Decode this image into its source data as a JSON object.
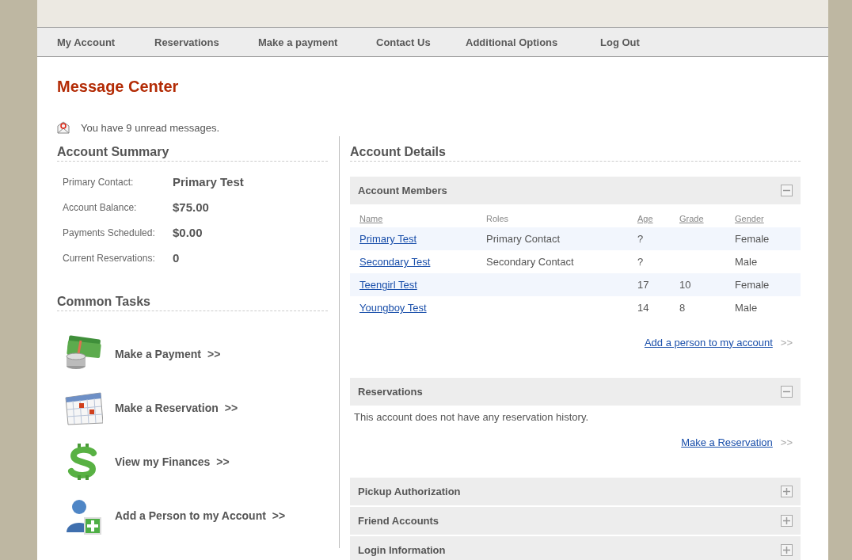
{
  "nav": [
    {
      "label": "My Account"
    },
    {
      "label": "Reservations"
    },
    {
      "label": "Make a payment"
    },
    {
      "label": "Contact Us"
    },
    {
      "label": "Additional Options"
    },
    {
      "label": "Log Out"
    }
  ],
  "page_title": "Message Center",
  "unread_notice": "You have 9 unread messages.",
  "account_summary": {
    "heading": "Account Summary",
    "rows": [
      {
        "label": "Primary Contact:",
        "value": "Primary Test"
      },
      {
        "label": "Account Balance:",
        "value": "$75.00"
      },
      {
        "label": "Payments Scheduled:",
        "value": "$0.00"
      },
      {
        "label": "Current Reservations:",
        "value": "0"
      }
    ]
  },
  "common_tasks": {
    "heading": "Common Tasks",
    "items": [
      {
        "kind": "payment",
        "label": "Make a Payment",
        "arrow": ">>"
      },
      {
        "kind": "calendar",
        "label": "Make a Reservation",
        "arrow": ">>"
      },
      {
        "kind": "dollar",
        "label": "View my Finances",
        "arrow": ">>"
      },
      {
        "kind": "person",
        "label": "Add a Person to my Account",
        "arrow": ">>"
      }
    ]
  },
  "account_details": {
    "heading": "Account Details",
    "panels": [
      {
        "kind": "members",
        "title": "Account Members",
        "expanded": true,
        "columns": [
          {
            "label": "Name",
            "sortable": true
          },
          {
            "label": "Roles",
            "sortable": false
          },
          {
            "label": "Age",
            "sortable": true
          },
          {
            "label": "Grade",
            "sortable": true
          },
          {
            "label": "Gender",
            "sortable": true
          }
        ],
        "rows": [
          {
            "name": "Primary Test",
            "role": "Primary Contact",
            "age": "?",
            "gender": "Female"
          },
          {
            "name": "Secondary Test",
            "role": "Secondary Contact",
            "age": "?",
            "gender": "Male"
          },
          {
            "name": "Teengirl Test",
            "age": "17",
            "grade": "10",
            "gender": "Female"
          },
          {
            "name": "Youngboy Test",
            "age": "14",
            "grade": "8",
            "gender": "Male"
          }
        ],
        "link": "Add a person to my account",
        "arrow": ">>"
      },
      {
        "kind": "reservations",
        "title": "Reservations",
        "expanded": true,
        "message": "This account does not have any reservation history.",
        "link": "Make a Reservation",
        "arrow": ">>"
      },
      {
        "title": "Pickup Authorization",
        "expanded": false
      },
      {
        "title": "Friend Accounts",
        "expanded": false
      },
      {
        "title": "Login Information",
        "expanded": false
      }
    ]
  }
}
